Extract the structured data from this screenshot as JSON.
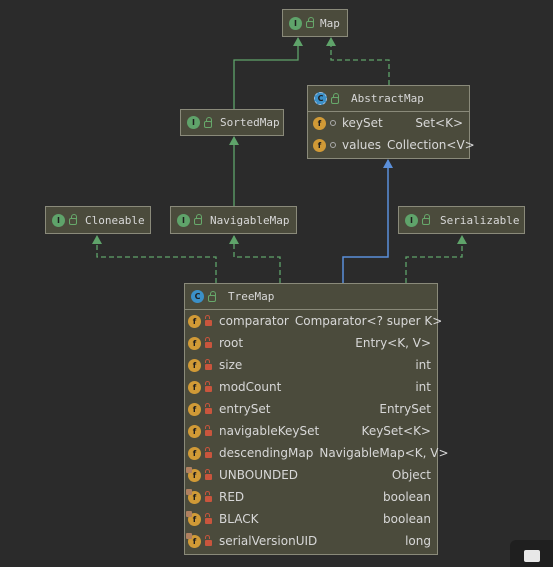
{
  "colors": {
    "background": "#2b2b2b",
    "node_fill": "#4b4b3c",
    "node_border": "#8a8a7a",
    "interface_arrow": "#5fa36a",
    "class_arrow": "#5b8fd9"
  },
  "nodes": {
    "map": {
      "kind": "interface",
      "icon": "I",
      "name": "Map"
    },
    "sortedmap": {
      "kind": "interface",
      "icon": "I",
      "name": "SortedMap"
    },
    "abstractmap": {
      "kind": "abstract-class",
      "icon": "C",
      "name": "AbstractMap",
      "fields": [
        {
          "icon": "f",
          "visibility": "package",
          "name": "keySet",
          "type": "Set<K>"
        },
        {
          "icon": "f",
          "visibility": "package",
          "name": "values",
          "type": "Collection<V>"
        }
      ]
    },
    "cloneable": {
      "kind": "interface",
      "icon": "I",
      "name": "Cloneable"
    },
    "navigablemap": {
      "kind": "interface",
      "icon": "I",
      "name": "NavigableMap"
    },
    "serializable": {
      "kind": "interface",
      "icon": "I",
      "name": "Serializable"
    },
    "treemap": {
      "kind": "class",
      "icon": "C",
      "name": "TreeMap",
      "fields": [
        {
          "icon": "f",
          "visibility": "private",
          "name": "comparator",
          "type": "Comparator<? super K>"
        },
        {
          "icon": "f",
          "visibility": "private",
          "name": "root",
          "type": "Entry<K, V>"
        },
        {
          "icon": "f",
          "visibility": "private",
          "name": "size",
          "type": "int"
        },
        {
          "icon": "f",
          "visibility": "private",
          "name": "modCount",
          "type": "int"
        },
        {
          "icon": "f",
          "visibility": "private",
          "name": "entrySet",
          "type": "EntrySet"
        },
        {
          "icon": "f",
          "visibility": "private",
          "name": "navigableKeySet",
          "type": "KeySet<K>"
        },
        {
          "icon": "f",
          "visibility": "private",
          "name": "descendingMap",
          "type": "NavigableMap<K, V>"
        },
        {
          "icon": "f",
          "visibility": "private",
          "static": true,
          "name": "UNBOUNDED",
          "type": "Object"
        },
        {
          "icon": "f",
          "visibility": "private",
          "static": true,
          "name": "RED",
          "type": "boolean"
        },
        {
          "icon": "f",
          "visibility": "private",
          "static": true,
          "name": "BLACK",
          "type": "boolean"
        },
        {
          "icon": "f",
          "visibility": "private",
          "static": true,
          "name": "serialVersionUID",
          "type": "long"
        }
      ]
    }
  },
  "edges": [
    {
      "from": "sortedmap",
      "to": "map",
      "style": "extends-interface"
    },
    {
      "from": "abstractmap",
      "to": "map",
      "style": "implements"
    },
    {
      "from": "navigablemap",
      "to": "sortedmap",
      "style": "extends-interface"
    },
    {
      "from": "treemap",
      "to": "abstractmap",
      "style": "extends-class"
    },
    {
      "from": "treemap",
      "to": "cloneable",
      "style": "implements"
    },
    {
      "from": "treemap",
      "to": "navigablemap",
      "style": "implements"
    },
    {
      "from": "treemap",
      "to": "serializable",
      "style": "implements"
    }
  ]
}
